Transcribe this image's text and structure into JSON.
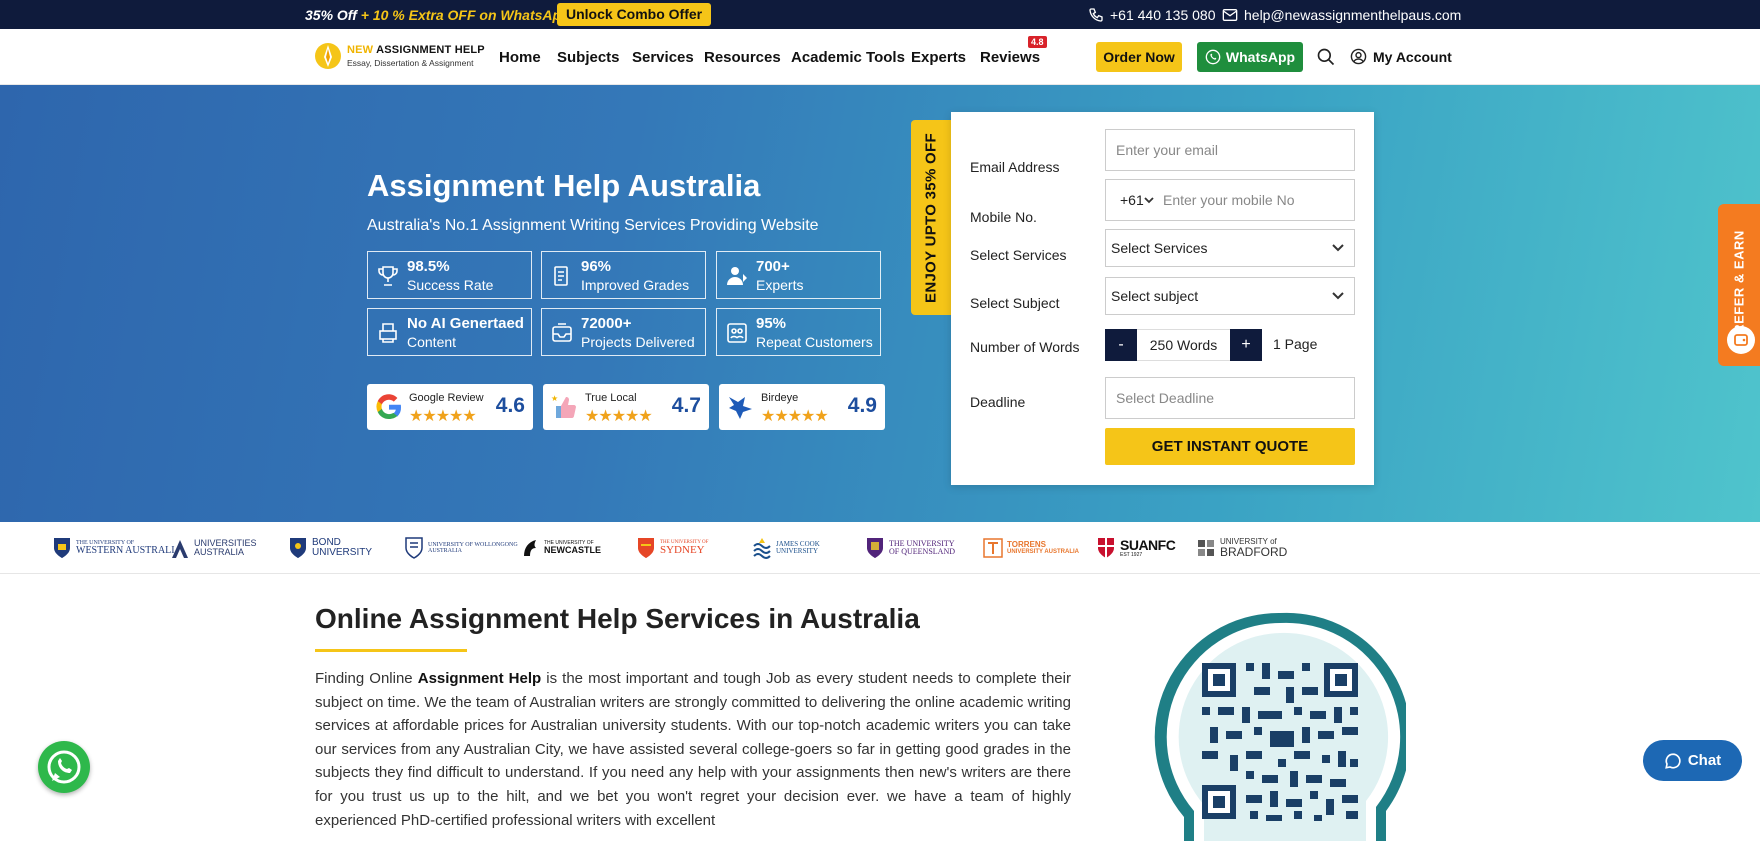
{
  "topbar": {
    "promo_part1": "35% Off",
    "promo_part2": " + 10 % Extra OFF on WhatsApp",
    "combo_label": "Unlock Combo Offer",
    "phone": "+61 440 135 080",
    "email": "help@newassignmenthelpaus.com"
  },
  "nav": {
    "logo_line1_a": "NEW",
    "logo_line1_b": " ASSIGNMENT HELP",
    "logo_line2": "Essay, Dissertation & Assignment",
    "items": [
      "Home",
      "Subjects",
      "Services",
      "Resources",
      "Academic Tools",
      "Experts",
      "Reviews"
    ],
    "reviews_badge": "4.8",
    "order_label": "Order Now",
    "whatsapp_label": "WhatsApp",
    "account_label": "My Account"
  },
  "hero": {
    "title": "Assignment Help Australia",
    "subtitle": "Australia's No.1 Assignment Writing Services Providing Website",
    "stats": [
      {
        "value": "98.5%",
        "label": "Success Rate",
        "icon": "trophy-icon"
      },
      {
        "value": "96%",
        "label": "Improved Grades",
        "icon": "document-icon"
      },
      {
        "value": "700+",
        "label": "Experts",
        "icon": "expert-icon"
      },
      {
        "value": "No AI Genertaed",
        "label": "Content",
        "icon": "printer-icon"
      },
      {
        "value": "72000+",
        "label": "Projects Delivered",
        "icon": "inbox-icon"
      },
      {
        "value": "95%",
        "label": "Repeat Customers",
        "icon": "customers-icon"
      }
    ],
    "reviews": [
      {
        "name": "Google Review",
        "stars": "★★★★★",
        "score": "4.6",
        "icon": "google-icon"
      },
      {
        "name": "True Local",
        "stars": "★★★★★",
        "score": "4.7",
        "icon": "truelocal-icon"
      },
      {
        "name": "Birdeye",
        "stars": "★★★★★",
        "score": "4.9",
        "icon": "birdeye-icon"
      }
    ],
    "offer_tab": "ENJOY UPTO 35% OFF"
  },
  "form": {
    "email_label": "Email Address",
    "email_placeholder": "Enter your email",
    "mobile_label": "Mobile No.",
    "country_code": "+61",
    "mobile_placeholder": "Enter your mobile No",
    "services_label": "Select Services",
    "services_value": "Select Services",
    "subject_label": "Select Subject",
    "subject_value": "Select subject",
    "words_label": "Number of Words",
    "minus": "-",
    "words_value": "250 Words",
    "plus": "+",
    "pages": "1 Page",
    "deadline_label": "Deadline",
    "deadline_placeholder": "Select Deadline",
    "submit": "GET INSTANT QUOTE"
  },
  "refer": "REFER & EARN",
  "universities": [
    {
      "line1": "THE UNIVERSITY OF",
      "line2": "WESTERN AUSTRALIA",
      "color": "#1f3a7a"
    },
    {
      "line1": "UNIVERSITIES",
      "line2": "AUSTRALIA",
      "color": "#2a3b6e"
    },
    {
      "line1": "BOND",
      "line2": "UNIVERSITY",
      "color": "#1f3a7a"
    },
    {
      "line1": "UNIVERSITY OF WOLLONGONG",
      "line2": "AUSTRALIA",
      "color": "#1f3a7a"
    },
    {
      "line1": "THE UNIVERSITY OF",
      "line2": "NEWCASTLE",
      "color": "#111111"
    },
    {
      "line1": "THE UNIVERSITY OF",
      "line2": "SYDNEY",
      "color": "#e64626"
    },
    {
      "line1": "JAMES COOK",
      "line2": "UNIVERSITY",
      "color": "#1a4f8b"
    },
    {
      "line1": "THE UNIVERSITY",
      "line2": "OF QUEENSLAND",
      "color": "#51247a"
    },
    {
      "line1": "TORRENS",
      "line2": "UNIVERSITY AUSTRALIA",
      "color": "#e8772e"
    },
    {
      "line1": "SUANFC",
      "line2": "EST 1927",
      "color": "#c8102e"
    },
    {
      "line1": "UNIVERSITY of",
      "line2": "BRADFORD",
      "color": "#333333"
    }
  ],
  "content": {
    "heading": "Online Assignment Help Services in Australia",
    "para_start": "Finding Online ",
    "para_bold": "Assignment Help",
    "para_rest": " is the most important and tough Job as every student needs to complete their subject on time. We the team of Australian writers are strongly committed to delivering the online academic writing services at affordable prices for Australian university students. With our top-notch academic writers you can take our services from any Australian City, we have assisted several college-goers so far in getting good grades in the subjects they find difficult to understand. If you need any help with your assignments then new's writers are there for you trust us up to the hilt, and we bet you won't regret your decision ever. we have a team of highly experienced PhD-certified professional writers with excellent"
  },
  "chat_label": "Chat",
  "colors": {
    "primary_dark": "#0f1b3c",
    "accent": "#f5c518",
    "whatsapp": "#1f8e3d",
    "refer": "#f47b20",
    "chat": "#1d68b4"
  }
}
